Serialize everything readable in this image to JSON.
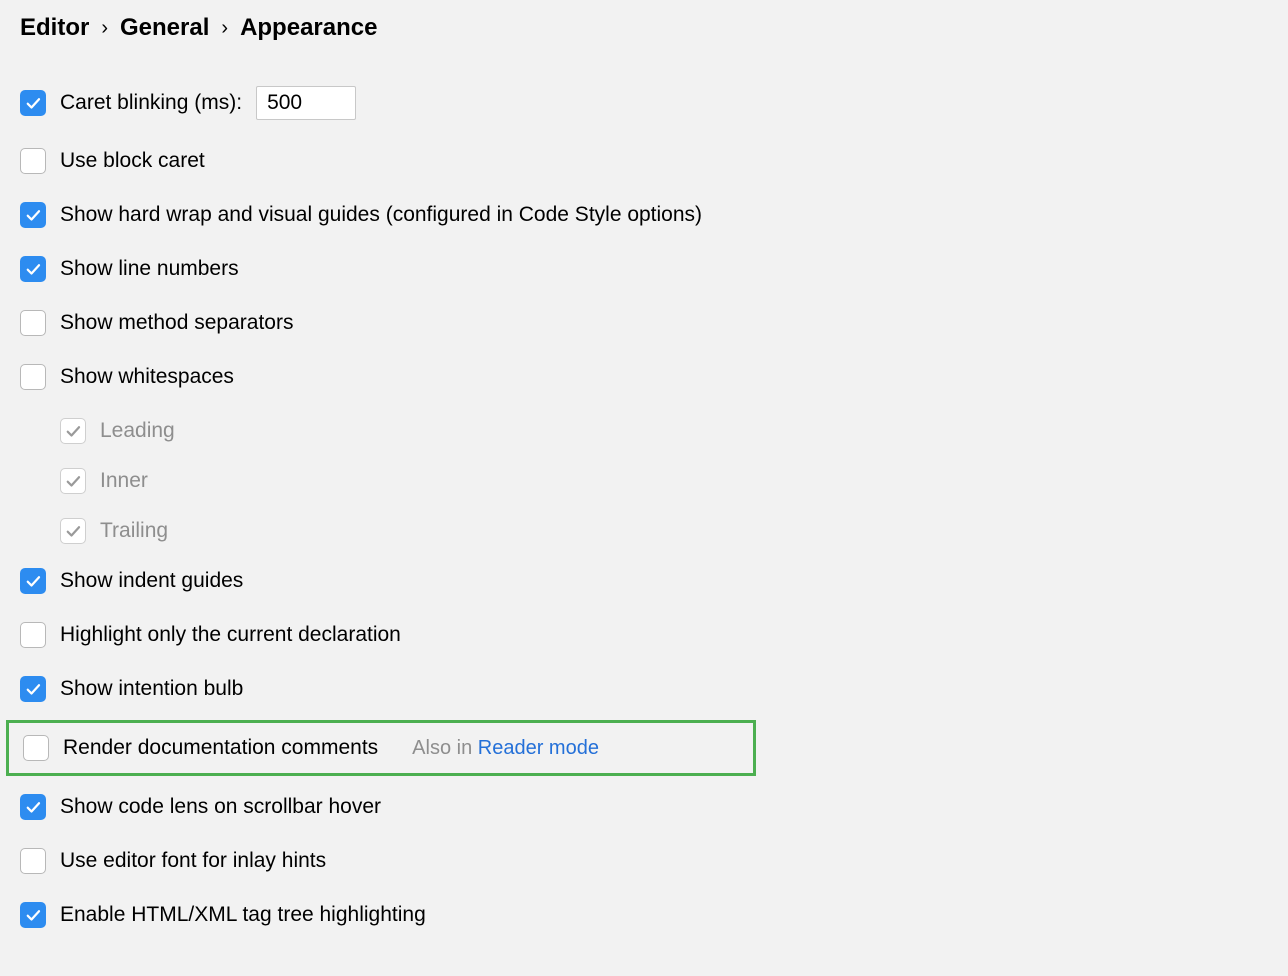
{
  "breadcrumb": [
    "Editor",
    "General",
    "Appearance"
  ],
  "options": {
    "caret_blinking_label": "Caret blinking (ms):",
    "caret_blinking_value": "500",
    "use_block_caret": "Use block caret",
    "show_hard_wrap": "Show hard wrap and visual guides (configured in Code Style options)",
    "show_line_numbers": "Show line numbers",
    "show_method_separators": "Show method separators",
    "show_whitespaces": "Show whitespaces",
    "whitespace_leading": "Leading",
    "whitespace_inner": "Inner",
    "whitespace_trailing": "Trailing",
    "show_indent_guides": "Show indent guides",
    "highlight_current_decl": "Highlight only the current declaration",
    "show_intention_bulb": "Show intention bulb",
    "render_doc_comments": "Render documentation comments",
    "render_doc_note": "Also in ",
    "render_doc_link": "Reader mode",
    "show_code_lens": "Show code lens on scrollbar hover",
    "use_editor_font_inlay": "Use editor font for inlay hints",
    "enable_html_xml_tag": "Enable HTML/XML tag tree highlighting"
  }
}
